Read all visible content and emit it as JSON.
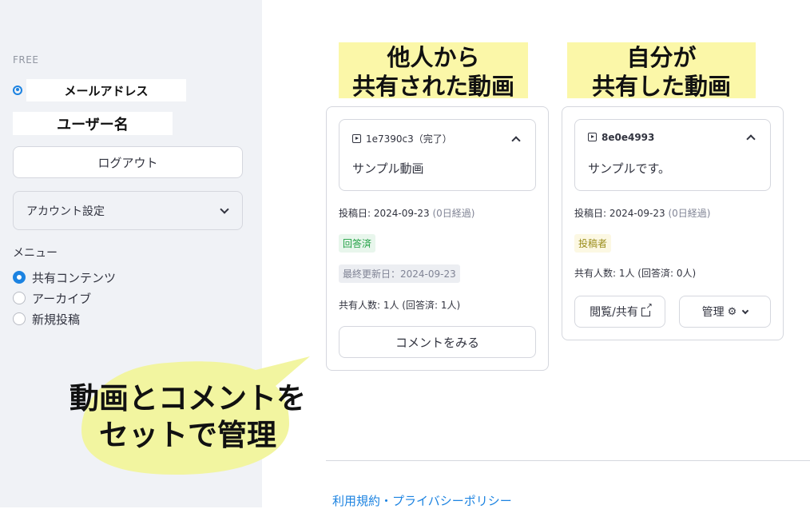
{
  "sidebar": {
    "plan": "FREE",
    "email": "メールアドレス",
    "username": "ユーザー名",
    "logout_label": "ログアウト",
    "account_settings_label": "アカウント設定",
    "menu_label": "メニュー",
    "menu_items": [
      {
        "label": "共有コンテンツ",
        "selected": true
      },
      {
        "label": "アーカイブ",
        "selected": false
      },
      {
        "label": "新規投稿",
        "selected": false
      }
    ]
  },
  "callout": {
    "line1": "動画とコメントを",
    "line2": "セットで管理",
    "color": "#f2f5a0"
  },
  "headlines": {
    "left_line1": "他人から",
    "left_line2": "共有された動画",
    "right_line1": "自分が",
    "right_line2": "共有した動画",
    "highlight_color": "#fbf7a8"
  },
  "cards": [
    {
      "id_text": "1e7390c3（完了）",
      "body": "サンプル動画",
      "posted_label": "投稿日: 2024-09-23",
      "posted_elapsed": "(0日経過)",
      "tag1": "回答済",
      "tag2": "最終更新日：2024-09-23",
      "shared_count": "共有人数: 1人 (回答済: 1人)",
      "button": "コメントをみる"
    },
    {
      "id_text": "8e0e4993",
      "body": "サンプルです。",
      "posted_label": "投稿日: 2024-09-23",
      "posted_elapsed": "(0日経過)",
      "tag1": "投稿者",
      "shared_count": "共有人数: 1人 (回答済: 0人)",
      "view_button": "閲覧/共有",
      "manage_button": "管理"
    }
  ],
  "footer": {
    "link": "利用規約・プライバシーポリシー"
  },
  "colors": {
    "accent": "#1c83e1",
    "sidebar_bg": "#f0f2f6"
  }
}
